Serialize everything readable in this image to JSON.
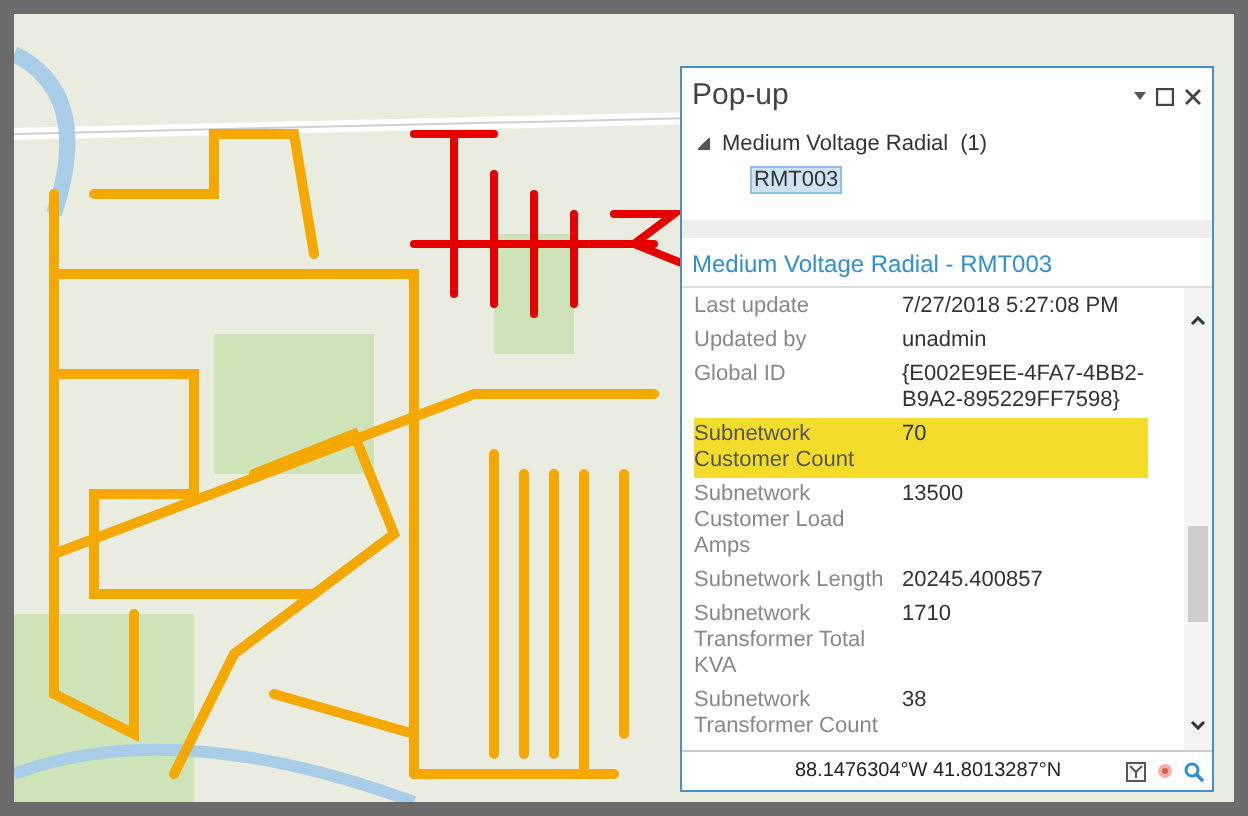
{
  "popup": {
    "title": "Pop-up",
    "tree": {
      "label": "Medium Voltage Radial",
      "count": "(1)",
      "expanded": true,
      "children": [
        {
          "label": "RMT003",
          "selected": true
        }
      ]
    },
    "feature_title": "Medium Voltage Radial - RMT003",
    "fields": [
      {
        "name": "Last update",
        "value": "7/27/2018 5:27:08 PM",
        "highlighted": false
      },
      {
        "name": "Updated by",
        "value": "unadmin",
        "highlighted": false
      },
      {
        "name": "Global ID",
        "value": "{E002E9EE-4FA7-4BB2-B9A2-895229FF7598}",
        "highlighted": false
      },
      {
        "name": "Subnetwork Customer Count",
        "value": "70",
        "highlighted": true
      },
      {
        "name": "Subnetwork Customer Load Amps",
        "value": "13500",
        "highlighted": false
      },
      {
        "name": "Subnetwork Length",
        "value": "20245.400857",
        "highlighted": false
      },
      {
        "name": "Subnetwork Transformer Total KVA",
        "value": "1710",
        "highlighted": false
      },
      {
        "name": "Subnetwork Transformer Count",
        "value": "38",
        "highlighted": false
      }
    ],
    "coordinates": "88.1476304°W 41.8013287°N"
  }
}
